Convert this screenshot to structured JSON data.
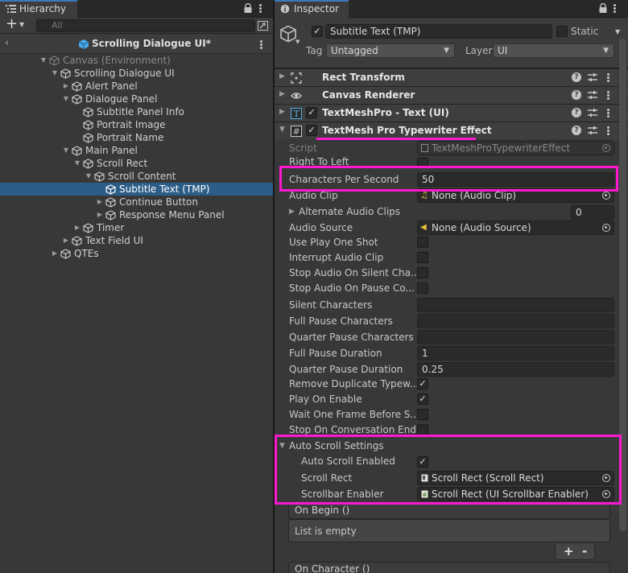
{
  "hierarchy": {
    "tab_label": "Hierarchy",
    "search_placeholder": "All",
    "scene_title": "Scrolling Dialogue UI*",
    "items": [
      {
        "label": "Canvas (Environment)",
        "depth": 0,
        "arrow": "down",
        "dim": true
      },
      {
        "label": "Scrolling Dialogue UI",
        "depth": 1,
        "arrow": "down"
      },
      {
        "label": "Alert Panel",
        "depth": 2,
        "arrow": "right"
      },
      {
        "label": "Dialogue Panel",
        "depth": 2,
        "arrow": "down"
      },
      {
        "label": "Subtitle Panel Info",
        "depth": 3,
        "arrow": "none"
      },
      {
        "label": "Portrait Image",
        "depth": 3,
        "arrow": "none"
      },
      {
        "label": "Portrait Name",
        "depth": 3,
        "arrow": "none"
      },
      {
        "label": "Main Panel",
        "depth": 2,
        "arrow": "down"
      },
      {
        "label": "Scroll Rect",
        "depth": 3,
        "arrow": "down"
      },
      {
        "label": "Scroll Content",
        "depth": 4,
        "arrow": "down"
      },
      {
        "label": "Subtitle Text (TMP)",
        "depth": 5,
        "arrow": "none",
        "selected": true
      },
      {
        "label": "Continue Button",
        "depth": 5,
        "arrow": "right"
      },
      {
        "label": "Response Menu Panel",
        "depth": 5,
        "arrow": "right"
      },
      {
        "label": "Timer",
        "depth": 3,
        "arrow": "right"
      },
      {
        "label": "Text Field UI",
        "depth": 2,
        "arrow": "right"
      },
      {
        "label": "QTEs",
        "depth": 1,
        "arrow": "right"
      }
    ]
  },
  "inspector": {
    "tab_label": "Inspector",
    "object_name": "Subtitle Text (TMP)",
    "static_label": "Static",
    "tag_label": "Tag",
    "tag_value": "Untagged",
    "layer_label": "Layer",
    "layer_value": "UI",
    "components": [
      {
        "name": "Rect Transform",
        "icon": "rect-transform-icon",
        "has_toggle": false
      },
      {
        "name": "Canvas Renderer",
        "icon": "eye-icon",
        "has_toggle": false
      },
      {
        "name": "TextMeshPro - Text (UI)",
        "icon": "tmp-text-icon",
        "has_toggle": true
      },
      {
        "name": "TextMesh Pro Typewriter Effect",
        "icon": "script-icon",
        "has_toggle": true
      }
    ],
    "properties": {
      "script_label": "Script",
      "script_value": "TextMeshProTypewriterEffect",
      "right_to_left": "Right To Left",
      "chars_per_second_label": "Characters Per Second",
      "chars_per_second_value": "50",
      "audio_clip_label": "Audio Clip",
      "audio_clip_value": "None (Audio Clip)",
      "alt_audio_clips_label": "Alternate Audio Clips",
      "alt_audio_clips_value": "0",
      "audio_source_label": "Audio Source",
      "audio_source_value": "None (Audio Source)",
      "use_play_one_shot": "Use Play One Shot",
      "interrupt_audio_clip": "Interrupt Audio Clip",
      "stop_audio_silent": "Stop Audio On Silent Cha...",
      "stop_audio_pause": "Stop Audio On Pause Co...",
      "silent_chars": "Silent Characters",
      "full_pause_chars": "Full Pause Characters",
      "quarter_pause_chars": "Quarter Pause Characters",
      "full_pause_duration_label": "Full Pause Duration",
      "full_pause_duration_value": "1",
      "quarter_pause_duration_label": "Quarter Pause Duration",
      "quarter_pause_duration_value": "0.25",
      "remove_duplicate": "Remove Duplicate Typew...",
      "play_on_enable": "Play On Enable",
      "wait_one_frame": "Wait One Frame Before S...",
      "stop_on_conversation_end": "Stop On Conversation End",
      "auto_scroll_settings": "Auto Scroll Settings",
      "auto_scroll_enabled": "Auto Scroll Enabled",
      "scroll_rect_label": "Scroll Rect",
      "scroll_rect_value": "Scroll Rect (Scroll Rect)",
      "scrollbar_enabler_label": "Scrollbar Enabler",
      "scrollbar_enabler_value": "Scroll Rect (UI Scrollbar Enabler)",
      "on_begin": "On Begin ()",
      "list_empty": "List is empty",
      "on_character": "On Character ()",
      "plus": "+",
      "minus": "-"
    }
  },
  "colors": {
    "highlight": "#ff18d0",
    "selection": "#2c5d87",
    "accent_tab": "#3a79bb"
  }
}
